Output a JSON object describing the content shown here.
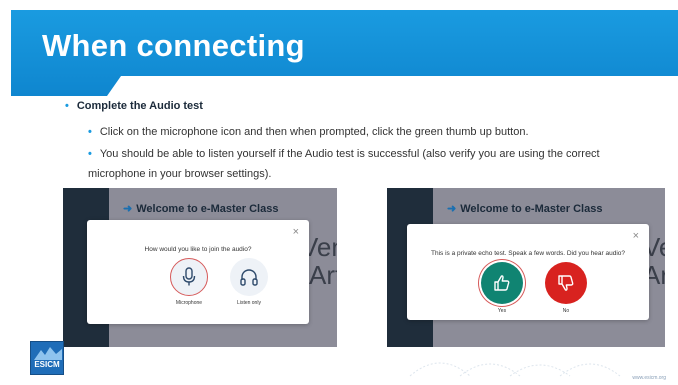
{
  "slide": {
    "title": "When connecting",
    "bullets": {
      "main": "Complete the Audio test",
      "sub1": "Click on the microphone icon and then when prompted, click the green thumb up button.",
      "sub2": "You should be able to listen yourself if the Audio test is successful (also verify you are using the correct microphone in your browser settings)."
    },
    "footer_url": "www.esicm.org"
  },
  "left_screenshot": {
    "header": "Welcome to e-Master Class",
    "bg_text": [
      "Ven",
      "Art"
    ],
    "dialog": {
      "close": "×",
      "question": "How would you like to join the audio?",
      "options": [
        {
          "label": "Microphone",
          "icon": "microphone-icon"
        },
        {
          "label": "Listen only",
          "icon": "headphones-icon"
        }
      ]
    }
  },
  "right_screenshot": {
    "header": "Welcome to e-Master Class",
    "bg_text": [
      "Ven",
      "Art"
    ],
    "dialog": {
      "close": "×",
      "question": "This is a private echo test. Speak a few words. Did you hear audio?",
      "options": [
        {
          "label": "Yes",
          "icon": "thumbs-up-icon",
          "color": "#108472"
        },
        {
          "label": "No",
          "icon": "thumbs-down-icon",
          "color": "#d8221f"
        }
      ]
    }
  },
  "logo": {
    "text": "ESICM"
  },
  "colors": {
    "accent": "#1a9be0",
    "yes": "#108472",
    "no": "#d8221f"
  }
}
